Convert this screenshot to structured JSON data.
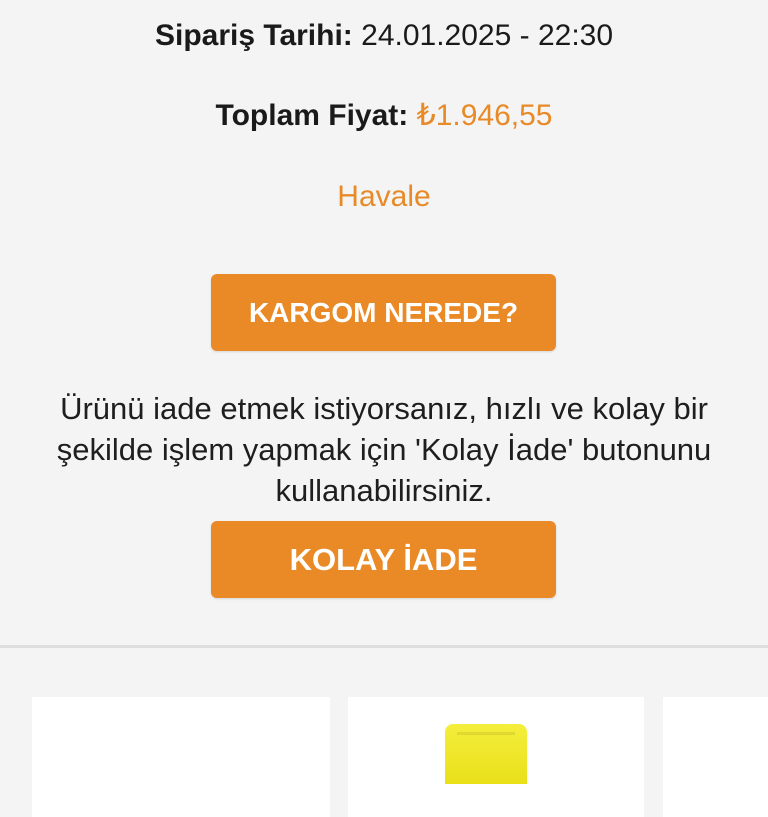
{
  "order": {
    "date_label": "Sipariş Tarihi:",
    "date_value": "24.01.2025 - 22:30",
    "total_label": "Toplam Fiyat:",
    "total_value": "₺1.946,55",
    "payment_method": "Havale"
  },
  "actions": {
    "track_label": "KARGOM NEREDE?",
    "return_info_lines": [
      "Ürünü iade etmek istiyorsanız, hızlı ve kolay bir",
      "şekilde işlem yapmak için 'Kolay İade' butonunu",
      "kullanabilirsiniz."
    ],
    "return_label": "KOLAY İADE"
  },
  "colors": {
    "accent": "#ea8a26",
    "background": "#f4f4f4"
  }
}
